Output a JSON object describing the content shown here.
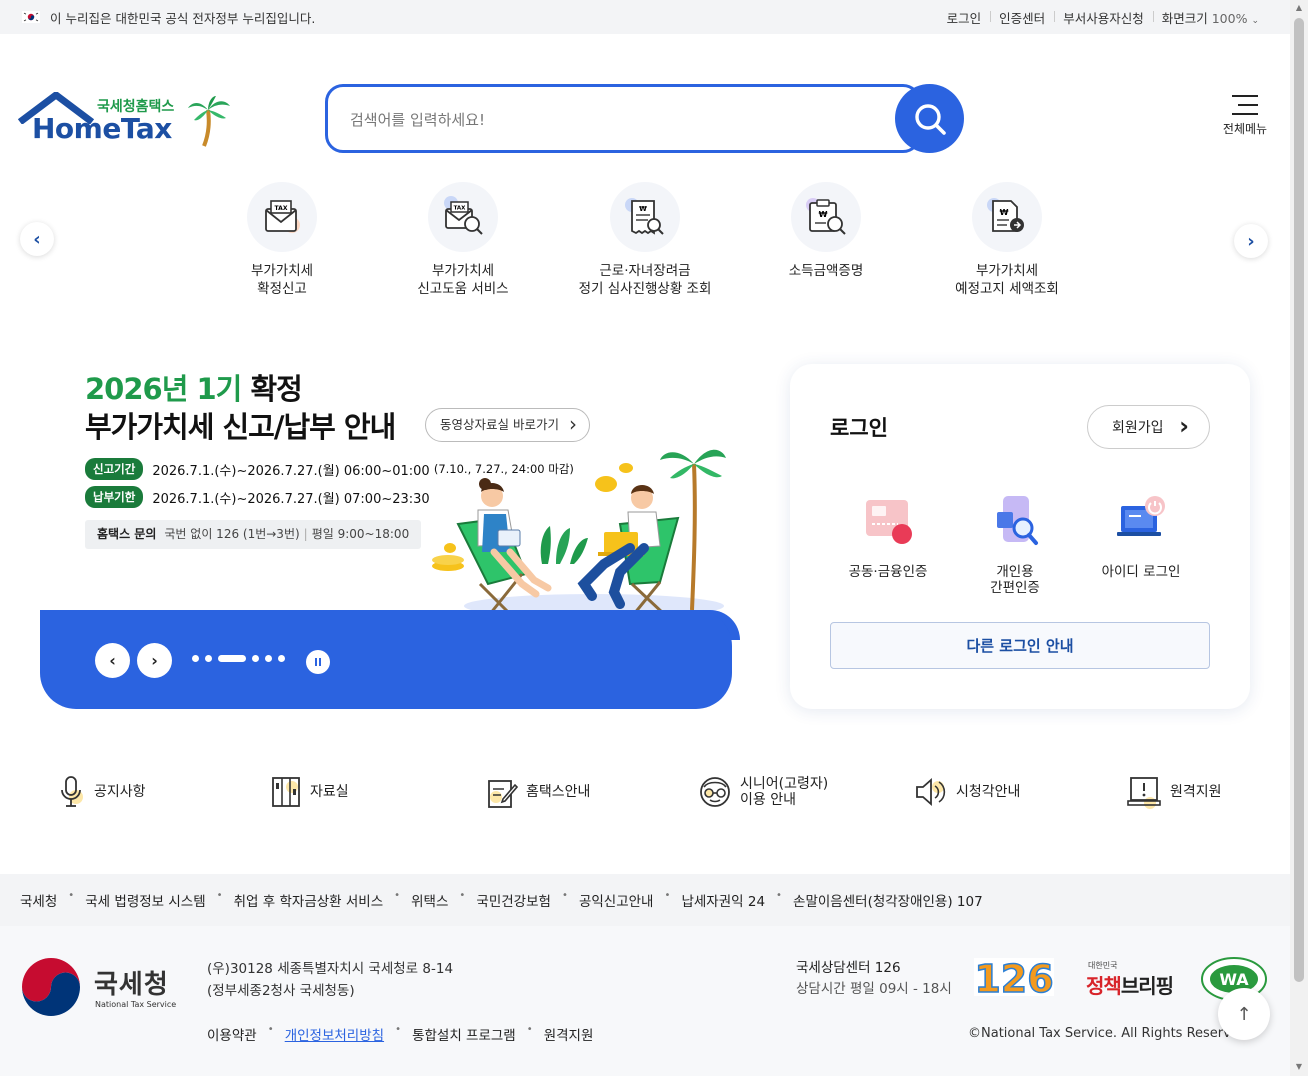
{
  "gov_bar": {
    "notice": "이 누리집은 대한민국 공식 전자정부 누리집입니다.",
    "links": [
      "로그인",
      "인증센터",
      "부서사용자신청"
    ],
    "zoom_label": "화면크기",
    "zoom_value": "100%"
  },
  "header": {
    "logo_ko": "국세청홈택스",
    "logo_en": "HomeTax",
    "search_placeholder": "검색어를 입력하세요!",
    "menu_label": "전체메뉴"
  },
  "quick": {
    "items": [
      {
        "line1": "부가가치세",
        "line2": "확정신고",
        "icon": "tax-envelope-icon"
      },
      {
        "line1": "부가가치세",
        "line2": "신고도움 서비스",
        "icon": "tax-search-icon"
      },
      {
        "line1": "근로·자녀장려금",
        "line2": "정기 심사진행상황 조회",
        "icon": "receipt-search-icon"
      },
      {
        "line1": "소득금액증명",
        "line2": "",
        "icon": "certificate-search-icon"
      },
      {
        "line1": "부가가치세",
        "line2": "예정고지 세액조회",
        "icon": "document-won-icon"
      }
    ]
  },
  "banner": {
    "title_year": "2026년 1기",
    "title_confirm": "확정",
    "title_line2": "부가가치세 신고/납부 안내",
    "video_link": "동영상자료실 바로가기",
    "period_tag": "신고기간",
    "period_text": "2026.7.1.(수)~2026.7.27.(월) 06:00~01:00",
    "period_note": "(7.10., 7.27., 24:00 마감)",
    "pay_tag": "납부기한",
    "pay_text": "2026.7.1.(수)~2026.7.27.(월) 07:00~23:30",
    "inquiry_label": "홈택스 문의",
    "inquiry_phone": "국번 없이 126 (1번→3번)",
    "inquiry_hours": "평일 9:00~18:00",
    "slide_count": 6,
    "active_slide": 3
  },
  "login": {
    "title": "로그인",
    "join_label": "회원가입",
    "options": [
      {
        "line1": "공동·금융인증",
        "line2": ""
      },
      {
        "line1": "개인용",
        "line2": "간편인증"
      },
      {
        "line1": "아이디 로그인",
        "line2": ""
      }
    ],
    "other_label": "다른 로그인 안내"
  },
  "services": [
    {
      "line1": "공지사항",
      "line2": "",
      "icon": "microphone-icon"
    },
    {
      "line1": "자료실",
      "line2": "",
      "icon": "archive-icon"
    },
    {
      "line1": "홈택스안내",
      "line2": "",
      "icon": "guide-edit-icon"
    },
    {
      "line1": "시니어(고령자)",
      "line2": "이용 안내",
      "icon": "senior-glasses-icon"
    },
    {
      "line1": "시청각안내",
      "line2": "",
      "icon": "speaker-icon"
    },
    {
      "line1": "원격지원",
      "line2": "",
      "icon": "remote-support-icon"
    }
  ],
  "related_links": [
    "국세청",
    "국세 법령정보 시스템",
    "취업 후 학자금상환 서비스",
    "위택스",
    "국민건강보험",
    "공익신고안내",
    "납세자권익 24",
    "손말이음센터(청각장애인용) 107"
  ],
  "footer": {
    "nts_ko": "국세청",
    "nts_en": "National Tax Service",
    "address1": "(우)30128 세종특별자치시 국세청로 8-14",
    "address2": "(정부세종2청사 국세청동)",
    "links": [
      "이용약관",
      "개인정보처리방침",
      "통합설치 프로그램",
      "원격지원"
    ],
    "center_title": "국세상담센터 126",
    "center_hours": "상담시간 평일 09시 - 18시",
    "badge_126": "126",
    "briefing_small": "대한민국",
    "briefing_a": "정책",
    "briefing_b": "브리핑",
    "wa_label": "WA",
    "copyright": "©National Tax Service. All Rights Reserved."
  },
  "colors": {
    "primary": "#2b63e0",
    "brand_green": "#1f9a4b",
    "brand_navy": "#1c4fa3",
    "tag_green": "#1a7b3b"
  }
}
